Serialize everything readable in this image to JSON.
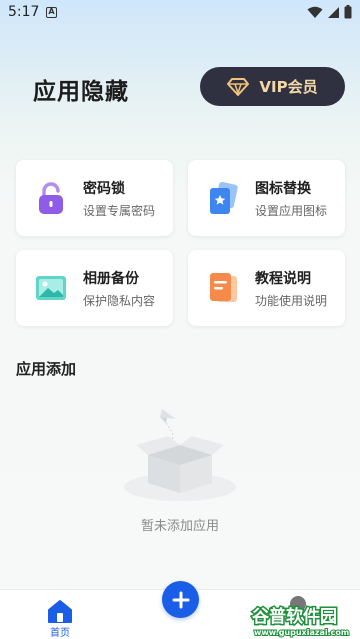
{
  "status_bar": {
    "time": "5:17",
    "notification_letter": "A"
  },
  "header": {
    "title": "应用隐藏",
    "vip_label": "VIP会员"
  },
  "cards": [
    {
      "title": "密码锁",
      "subtitle": "设置专属密码",
      "icon": "lock-icon"
    },
    {
      "title": "图标替换",
      "subtitle": "设置应用图标",
      "icon": "icon-replace-icon"
    },
    {
      "title": "相册备份",
      "subtitle": "保护隐私内容",
      "icon": "photo-album-icon"
    },
    {
      "title": "教程说明",
      "subtitle": "功能使用说明",
      "icon": "tutorial-icon"
    }
  ],
  "section": {
    "title": "应用添加"
  },
  "empty_state": {
    "text": "暂未添加应用"
  },
  "bottom_nav": {
    "home_label": "首页"
  },
  "watermark": {
    "text": "谷普软件园",
    "url_text": "www.gupuxiazai.com"
  },
  "colors": {
    "accent": "#1a5ee8",
    "vip_bg": "#2f3140",
    "vip_text": "#f3d9a8"
  }
}
